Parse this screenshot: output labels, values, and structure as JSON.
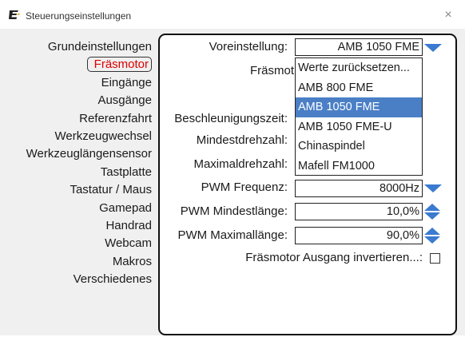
{
  "window": {
    "title": "Steuerungseinstellungen",
    "close_symbol": "×"
  },
  "nav": {
    "items": [
      {
        "label": "Grundeinstellungen"
      },
      {
        "label": "Fräsmotor",
        "selected": true
      },
      {
        "label": "Eingänge"
      },
      {
        "label": "Ausgänge"
      },
      {
        "label": "Referenzfahrt"
      },
      {
        "label": "Werkzeugwechsel"
      },
      {
        "label": "Werkzeuglängensensor"
      },
      {
        "label": "Tastplatte"
      },
      {
        "label": "Tastatur / Maus"
      },
      {
        "label": "Gamepad"
      },
      {
        "label": "Handrad"
      },
      {
        "label": "Webcam"
      },
      {
        "label": "Makros"
      },
      {
        "label": "Verschiedenes"
      }
    ]
  },
  "form": {
    "preset_label": "Voreinstellung:",
    "preset_value": "AMB 1050 FME",
    "motor_label_partial": "Fräsmot",
    "accel_label": "Beschleunigungszeit:",
    "min_speed_label": "Mindestdrehzahl:",
    "max_speed_label": "Maximaldrehzahl:",
    "pwm_freq_label": "PWM Frequenz:",
    "pwm_freq_value": "8000Hz",
    "pwm_min_label": "PWM Mindestlänge:",
    "pwm_min_value": "10,0%",
    "pwm_max_label": "PWM Maximallänge:",
    "pwm_max_value": "90,0%",
    "invert_label": "Fräsmotor Ausgang invertieren...:",
    "invert_checked": false
  },
  "dropdown": {
    "options": [
      {
        "label": "Werte zurücksetzen..."
      },
      {
        "label": "AMB 800 FME"
      },
      {
        "label": "AMB 1050 FME",
        "active": true
      },
      {
        "label": "AMB 1050 FME-U"
      },
      {
        "label": "Chinaspindel"
      },
      {
        "label": "Mafell FM1000"
      }
    ]
  },
  "colors": {
    "accent": "#3a7ad0",
    "selected_nav": "#e00000",
    "highlight": "#4a7fc6"
  }
}
